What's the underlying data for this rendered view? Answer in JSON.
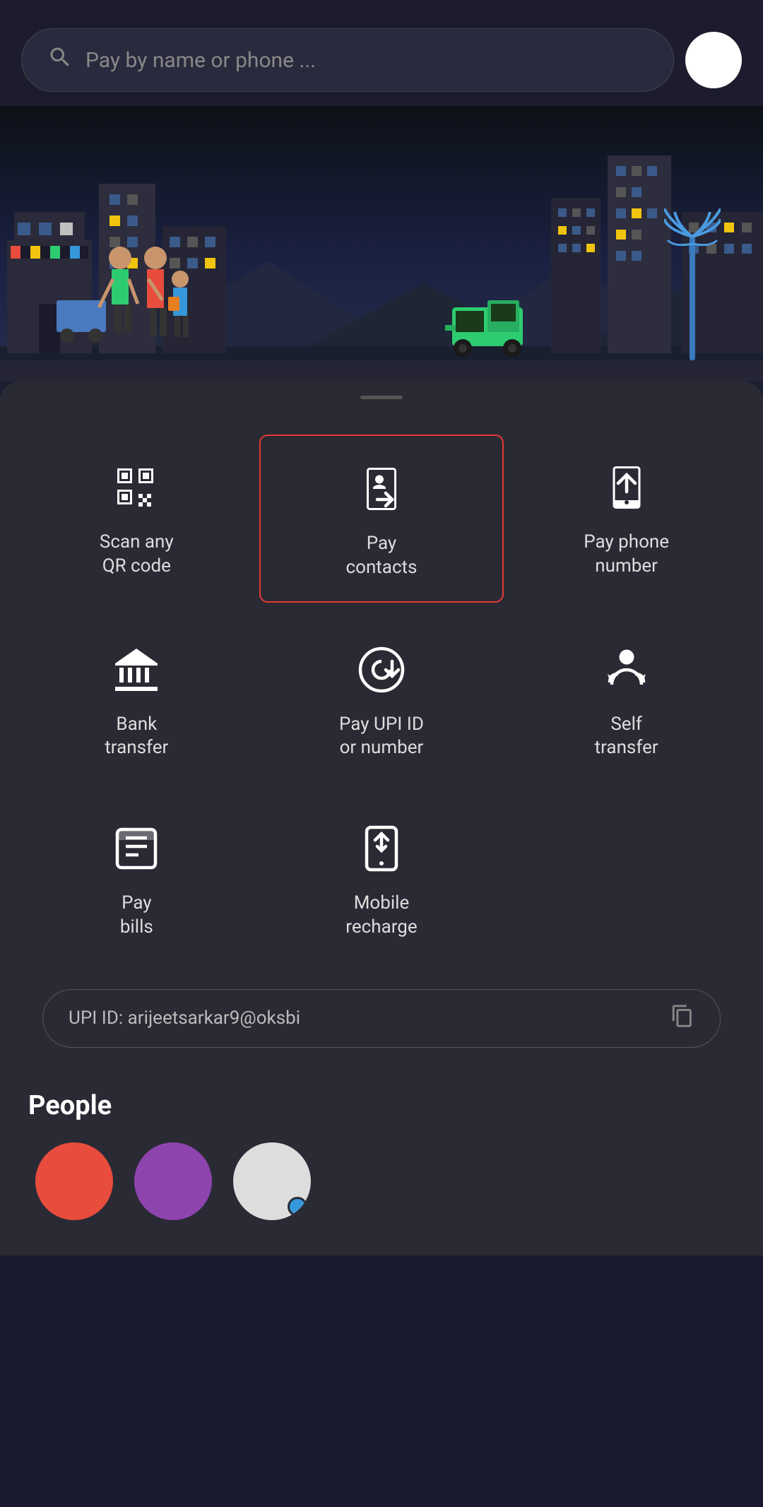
{
  "header": {
    "search_placeholder": "Pay by name or phone ...",
    "search_icon": "search-icon"
  },
  "actions": {
    "row1": [
      {
        "id": "scan-qr",
        "label": "Scan any\nQR code",
        "highlighted": false,
        "icon": "qr-code-icon"
      },
      {
        "id": "pay-contacts",
        "label": "Pay\ncontacts",
        "highlighted": true,
        "icon": "pay-contacts-icon"
      },
      {
        "id": "pay-phone",
        "label": "Pay phone\nnumber",
        "highlighted": false,
        "icon": "pay-phone-icon"
      }
    ],
    "row2": [
      {
        "id": "bank-transfer",
        "label": "Bank\ntransfer",
        "highlighted": false,
        "icon": "bank-icon"
      },
      {
        "id": "pay-upi",
        "label": "Pay UPI ID\nor number",
        "highlighted": false,
        "icon": "upi-icon"
      },
      {
        "id": "self-transfer",
        "label": "Self\ntransfer",
        "highlighted": false,
        "icon": "self-transfer-icon"
      }
    ],
    "row3": [
      {
        "id": "pay-bills",
        "label": "Pay\nbills",
        "highlighted": false,
        "icon": "bills-icon"
      },
      {
        "id": "mobile-recharge",
        "label": "Mobile\nrecharge",
        "highlighted": false,
        "icon": "mobile-icon"
      }
    ]
  },
  "upi_id": {
    "label": "UPI ID: arijeetsarkar9@oksbi",
    "copy_icon": "copy-icon"
  },
  "people_section": {
    "title": "People"
  }
}
